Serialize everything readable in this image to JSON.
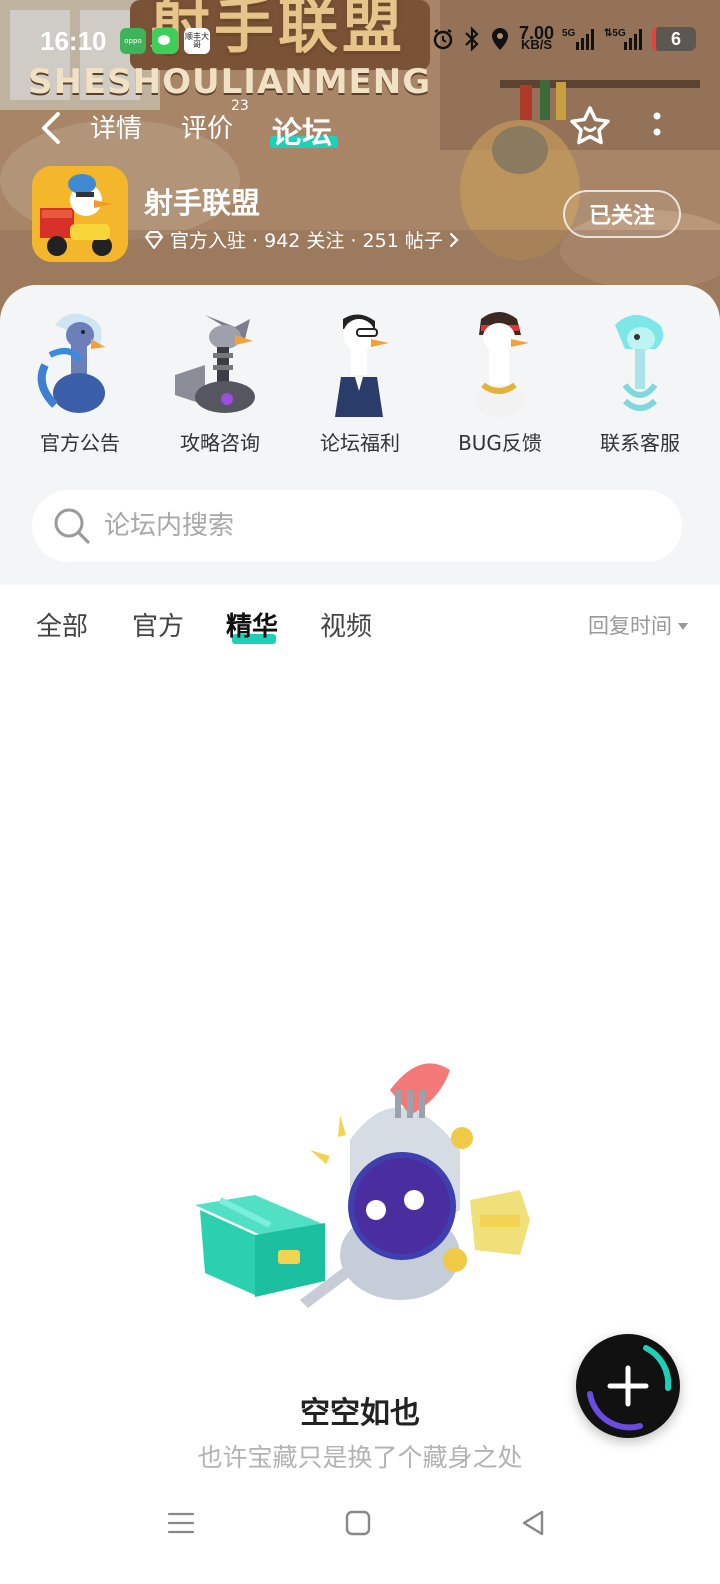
{
  "status_bar": {
    "time": "16:10",
    "app_icons": [
      "oppo",
      "wechat",
      "顺丰大哥"
    ],
    "net_speed_value": "7.00",
    "net_speed_unit": "KB/S",
    "battery": "6"
  },
  "banner": {
    "title_art": "射手联盟",
    "subtitle_art": "SHESHOULIANMENG"
  },
  "nav": {
    "tabs": [
      {
        "label": "详情"
      },
      {
        "label": "评价",
        "count": "23"
      },
      {
        "label": "论坛"
      }
    ],
    "active_tab": "论坛"
  },
  "game": {
    "name": "射手联盟",
    "meta": "官方入驻 · 942 关注 · 251 帖子",
    "follow_label": "已关注"
  },
  "categories": [
    {
      "label": "官方公告",
      "icon": "goose-blue-icon"
    },
    {
      "label": "攻略咨询",
      "icon": "goose-mech-icon"
    },
    {
      "label": "论坛福利",
      "icon": "goose-suit-icon"
    },
    {
      "label": "BUG反馈",
      "icon": "goose-pirate-icon"
    },
    {
      "label": "联系客服",
      "icon": "goose-ghost-icon"
    }
  ],
  "search": {
    "placeholder": "论坛内搜索"
  },
  "filters": {
    "tabs": [
      "全部",
      "官方",
      "精华",
      "视频"
    ],
    "active": "精华",
    "sort_label": "回复时间"
  },
  "empty_state": {
    "title": "空空如也",
    "subtitle": "也许宝藏只是换了个藏身之处"
  },
  "colors": {
    "accent": "#1fd0b8",
    "panel_bg": "#f4f5f7"
  }
}
